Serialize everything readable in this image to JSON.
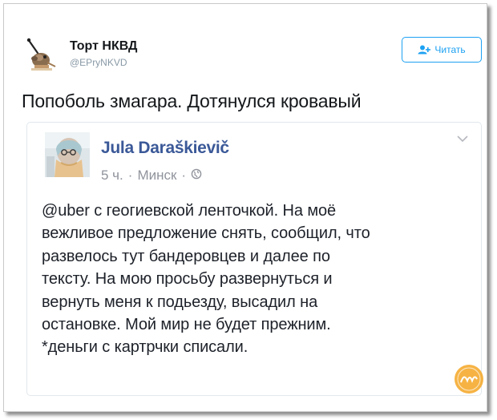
{
  "tweet": {
    "author_name": "Торт НКВД",
    "author_handle": "@EPryNKVD",
    "follow_label": "Читать",
    "text": "Попоболь змагара. Дотянулся кровавый"
  },
  "embedded_post": {
    "author_name": "Jula Daraškievič",
    "time": "5 ч.",
    "location": "Минск",
    "separator": "·",
    "body_lines": [
      "@uber с геогиевской ленточкой. На моё",
      "вежливое предложение снять, сообщил, что",
      "развелось тут бандеровцев и далее по",
      "тексту. На мою просьбу развернуться и",
      "вернуть меня к подьезду, высадил на",
      "остановке. Мой мир не будет прежним.",
      "*деньги с картрчки списали."
    ]
  },
  "icons": {
    "follow": "add-user-icon",
    "privacy": "globe-icon",
    "menu": "chevron-down-icon",
    "watermark": "watermark-logo"
  },
  "colors": {
    "twitter_blue": "#1da1f2",
    "fb_name": "#3b5998",
    "meta_gray": "#90949c",
    "watermark_orange": "#f5a623"
  }
}
